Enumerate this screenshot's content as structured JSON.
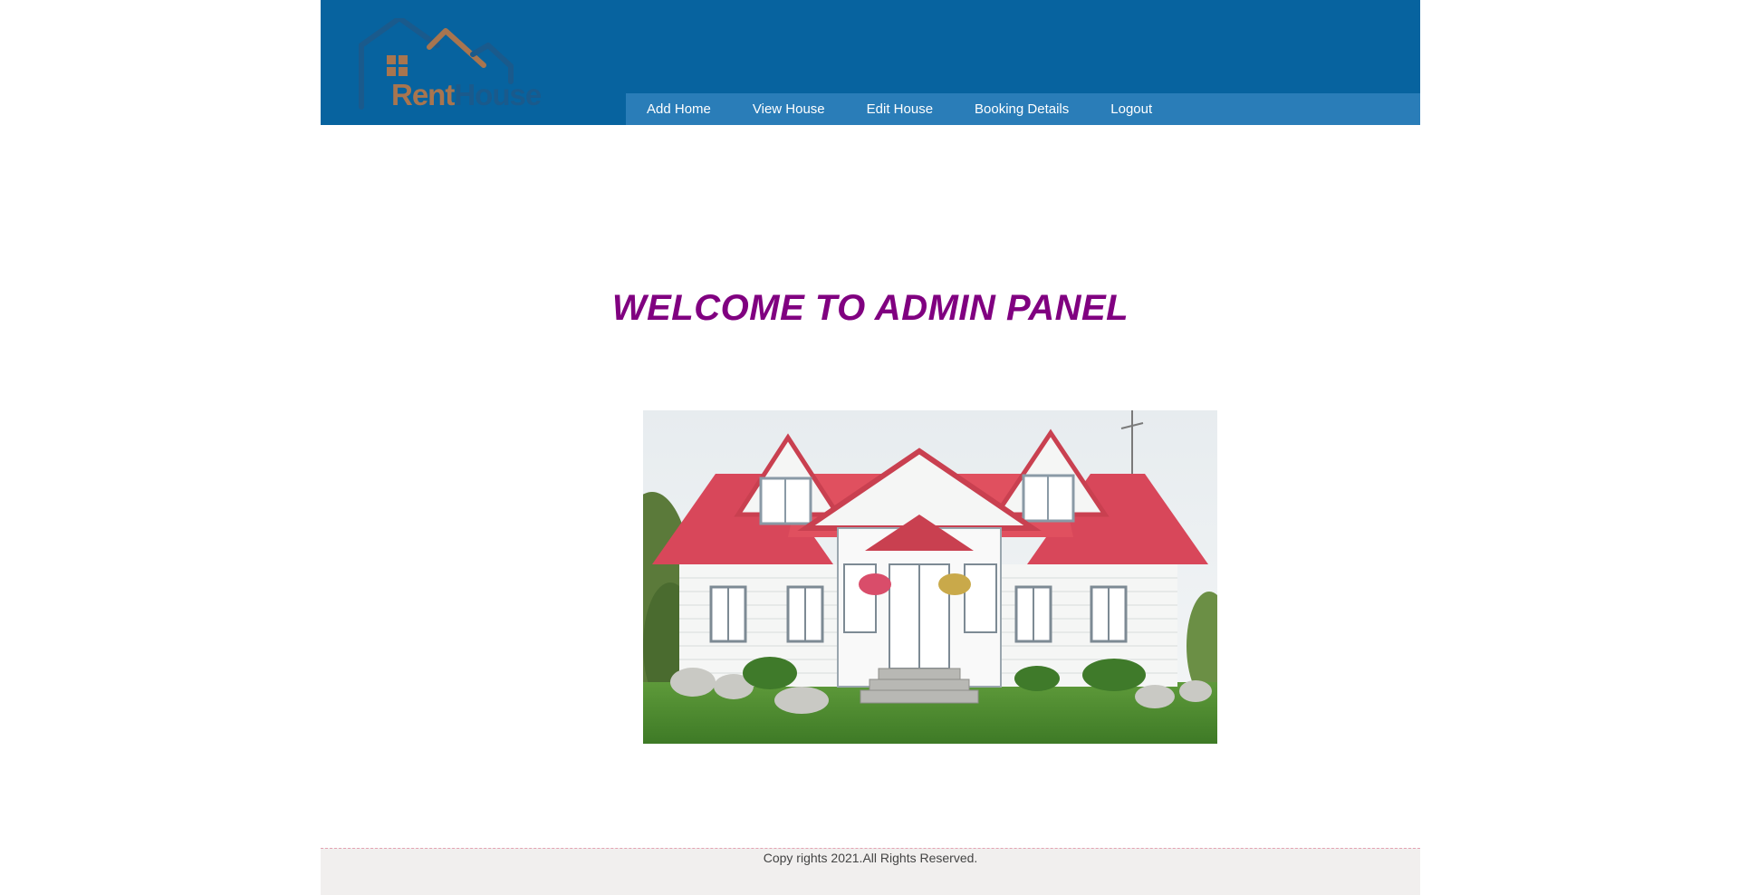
{
  "logo": {
    "text_rent": "Rent",
    "text_house": "House",
    "colors": {
      "rent": "#a8754f",
      "house": "#1a5a8c"
    }
  },
  "nav": {
    "items": [
      {
        "label": "Add Home"
      },
      {
        "label": "View House"
      },
      {
        "label": "Edit House"
      },
      {
        "label": "Booking Details"
      },
      {
        "label": "Logout"
      }
    ]
  },
  "main": {
    "welcome": "WELCOME TO ADMIN PANEL"
  },
  "footer": {
    "text": "Copy rights 2021.All Rights Reserved."
  },
  "colors": {
    "header": "#07639f",
    "nav_bar": "#2a7db8",
    "welcome": "#800080",
    "footer_bg": "#f1efee",
    "footer_border": "#e3a2b2"
  }
}
